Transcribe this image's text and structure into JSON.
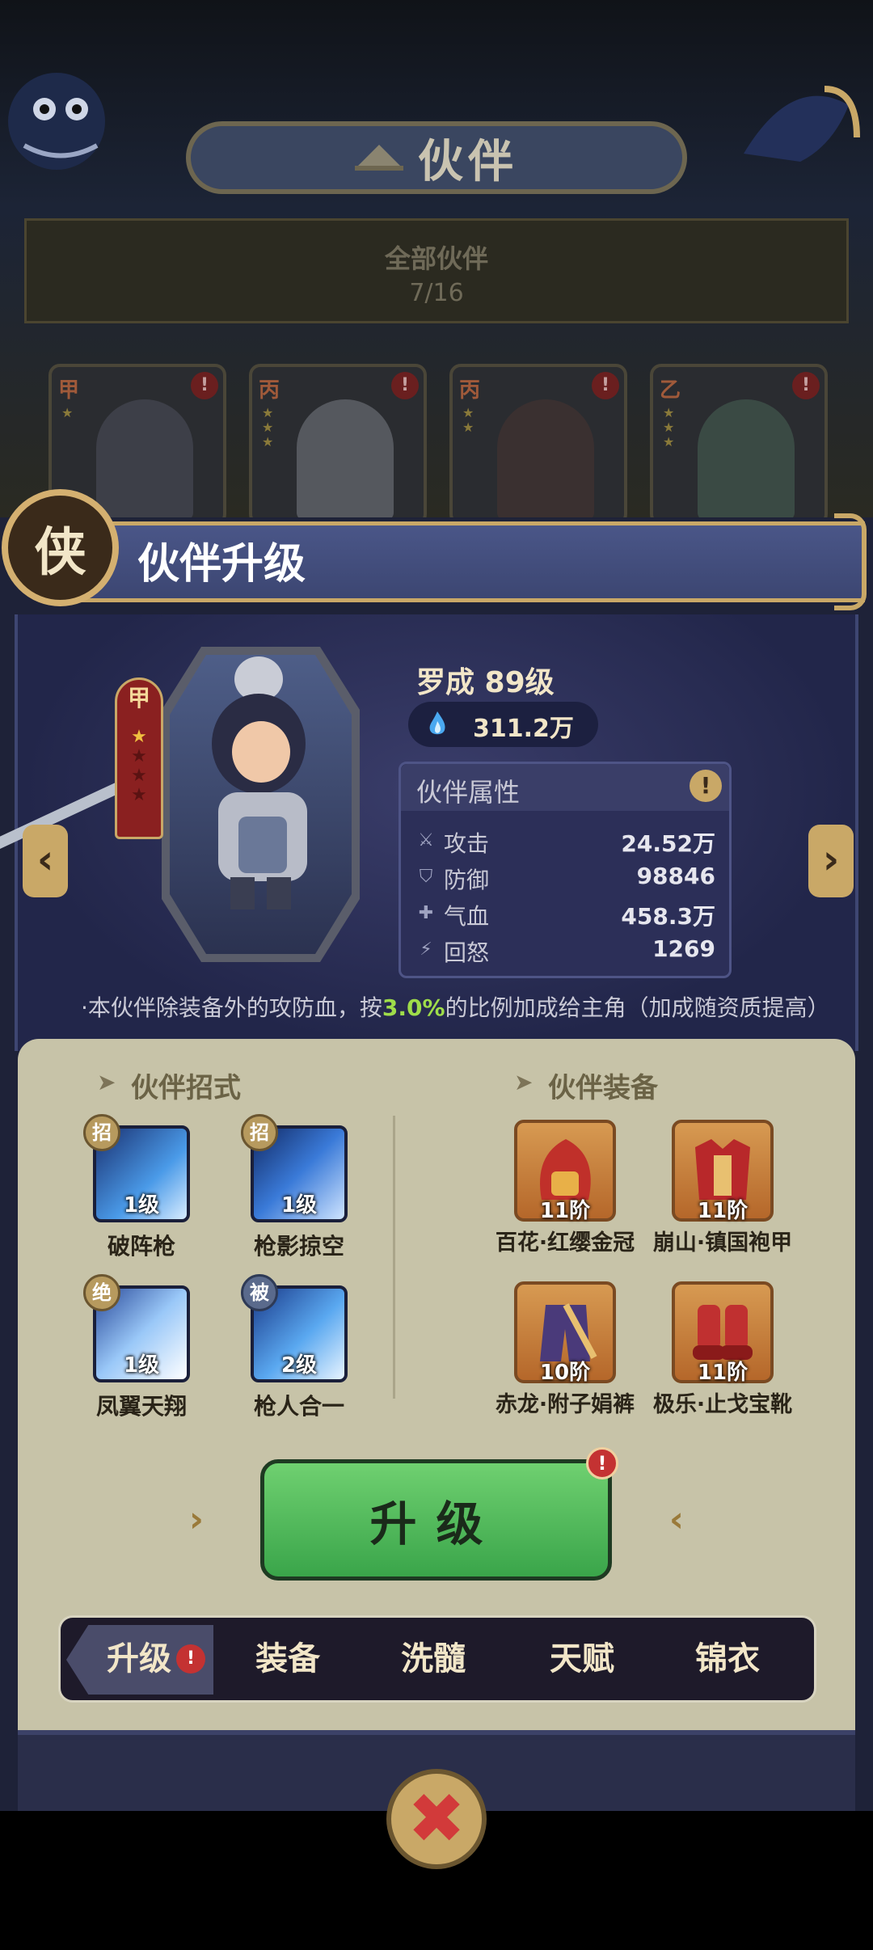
{
  "header": {
    "title": "伙伴",
    "all_partners_label": "全部伙伴",
    "all_partners_count": "7/16"
  },
  "partner_cards": [
    {
      "grade": "甲",
      "stars": 1
    },
    {
      "grade": "丙",
      "stars": 3
    },
    {
      "grade": "丙",
      "stars": 2
    },
    {
      "grade": "乙",
      "stars": 3
    }
  ],
  "panel": {
    "badge": "侠",
    "title": "伙伴升级"
  },
  "hero": {
    "grade": "甲",
    "stars_lit": 1,
    "stars_total": 4,
    "name_level": "罗成  89级",
    "power": "311.2万"
  },
  "attributes": {
    "title": "伙伴属性",
    "info_icon": "!",
    "rows": [
      {
        "icon": "attack-icon",
        "label": "攻击",
        "value": "24.52万"
      },
      {
        "icon": "defense-icon",
        "label": "防御",
        "value": "98846"
      },
      {
        "icon": "hp-icon",
        "label": "气血",
        "value": "458.3万"
      },
      {
        "icon": "rage-icon",
        "label": "回怒",
        "value": "1269"
      }
    ]
  },
  "bonus": {
    "prefix": "·本伙伴除装备外的攻防血，按",
    "percent": "3.0%",
    "suffix": "的比例加成给主角（加成随资质提高）"
  },
  "skills_section": {
    "title": "伙伴招式",
    "items": [
      {
        "tag": "招",
        "level": "1级",
        "name": "破阵枪"
      },
      {
        "tag": "招",
        "level": "1级",
        "name": "枪影掠空"
      },
      {
        "tag": "绝",
        "level": "1级",
        "name": "凤翼天翔"
      },
      {
        "tag": "被",
        "level": "2级",
        "name": "枪人合一"
      }
    ]
  },
  "equip_section": {
    "title": "伙伴装备",
    "items": [
      {
        "tier": "11阶",
        "name": "百花·红缨金冠"
      },
      {
        "tier": "11阶",
        "name": "崩山·镇国袍甲"
      },
      {
        "tier": "10阶",
        "name": "赤龙·附子娟裤"
      },
      {
        "tier": "11阶",
        "name": "极乐·止戈宝靴"
      }
    ]
  },
  "upgrade_button": "升级",
  "tabs": [
    "升级",
    "装备",
    "洗髓",
    "天赋",
    "锦衣"
  ],
  "alert_glyph": "!",
  "colors": {
    "accent_gold": "#c9a867",
    "upgrade_green": "#4cb85a",
    "alert_red": "#c43232",
    "bonus_green": "#9fdd4a"
  }
}
